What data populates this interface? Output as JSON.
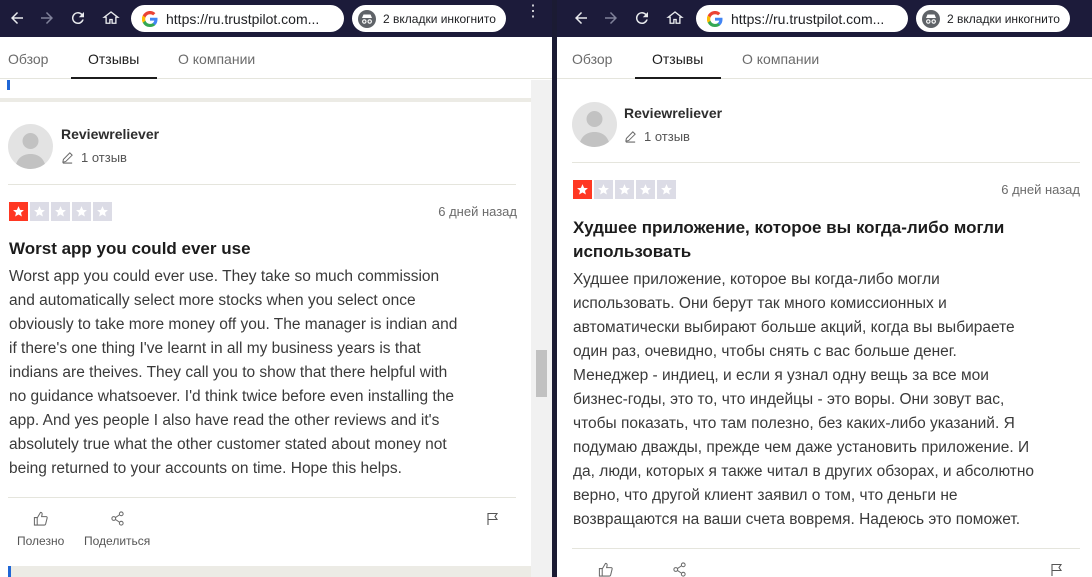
{
  "browser": {
    "url": "https://ru.trustpilot.com...",
    "incognito_label": "2 вкладки инкогнито"
  },
  "tabs": [
    "Обзор",
    "Отзывы",
    "О компании"
  ],
  "left": {
    "author": "Reviewreliever",
    "review_count": "1 отзыв",
    "rating": 1,
    "date": "6 дней назад",
    "title": "Worst app you could ever use",
    "body_lines": [
      "Worst app you could ever use. They take so much commission",
      "and automatically select more stocks when you select once",
      "obviously to take more money off you. The manager is indian and",
      "if there's one thing I've learnt in all my business years is that",
      "indians are theives. They call you to show that there helpful with",
      "no guidance whatsoever. I'd think twice before even installing the",
      "app. And yes people I also have read the other reviews and it's",
      "absolutely true what the other customer stated about money not",
      "being returned to your accounts on time. Hope this helps."
    ],
    "useful_label": "Полезно",
    "share_label": "Поделиться"
  },
  "right": {
    "author": "Reviewreliever",
    "review_count": "1 отзыв",
    "rating": 1,
    "date": "6 дней назад",
    "title_lines": [
      "Худшее приложение, которое вы когда-либо могли",
      "использовать"
    ],
    "body_lines": [
      "Худшее приложение, которое вы когда-либо могли",
      "использовать. Они берут так много комиссионных и",
      "автоматически выбирают больше акций, когда вы выбираете",
      "один раз, очевидно, чтобы снять с вас больше денег.",
      "Менеджер - индиец, и если я узнал одну вещь за все мои",
      "бизнес-годы, это то, что индейцы - это воры. Они зовут вас,",
      "чтобы показать, что там полезно, без каких-либо указаний. Я",
      "подумаю дважды, прежде чем даже установить приложение. И",
      "да, люди, которых я также читал в других обзорах, и абсолютно",
      "верно, что другой клиент заявил о том, что деньги не",
      "возвращаются на ваши счета вовремя. Надеюсь это поможет."
    ]
  },
  "colors": {
    "toolbar": "#1c1b3a",
    "star_red": "#ff3722",
    "star_grey": "#dcdce6",
    "accent_blue": "#1f66d6"
  }
}
